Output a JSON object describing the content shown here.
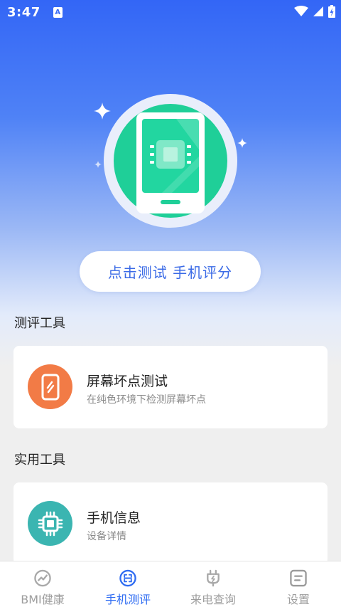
{
  "status_bar": {
    "time": "3:47",
    "notification_glyph": "A"
  },
  "hero": {
    "cta_label": "点击测试 手机评分"
  },
  "sections": {
    "evaluation_tools": {
      "title": "测评工具",
      "cards": [
        {
          "title": "屏幕坏点测试",
          "subtitle": "在纯色环境下检测屏幕坏点",
          "icon": "phone-screen-icon",
          "icon_color": "#f27b46"
        }
      ]
    },
    "practical_tools": {
      "title": "实用工具",
      "cards": [
        {
          "title": "手机信息",
          "subtitle": "设备详情",
          "icon": "chip-icon",
          "icon_color": "#3bb5b1"
        }
      ]
    }
  },
  "bottom_nav": {
    "items": [
      {
        "label": "BMI健康",
        "icon": "trend-icon",
        "active": false
      },
      {
        "label": "手机测评",
        "icon": "scan-icon",
        "active": true
      },
      {
        "label": "来电查询",
        "icon": "plug-icon",
        "active": false
      },
      {
        "label": "设置",
        "icon": "settings-icon",
        "active": false
      }
    ]
  },
  "colors": {
    "primary": "#2f6cf2",
    "hero_top": "#3366f6",
    "illustration_green": "#1fcf98",
    "card_orange": "#f27b46",
    "card_teal": "#3bb5b1"
  }
}
